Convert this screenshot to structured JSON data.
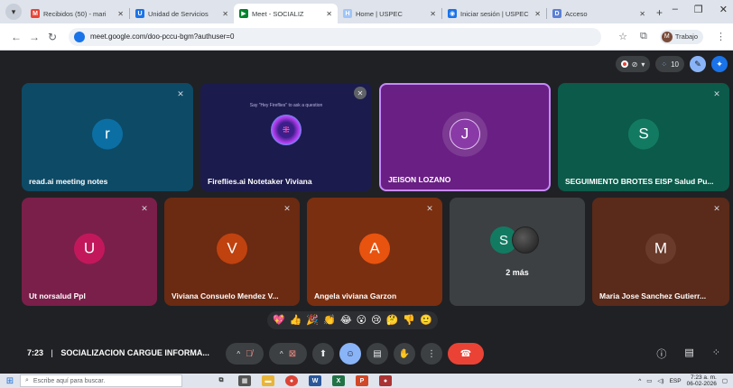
{
  "browser": {
    "tabs": [
      {
        "title": "Recibidos (50) - mari",
        "icon": "gmail-icon",
        "color": "#ea4335",
        "glyph": "M"
      },
      {
        "title": "Unidad de Servicios",
        "icon": "services-icon",
        "color": "#1a73e8",
        "glyph": "U"
      },
      {
        "title": "Meet - SOCIALIZ",
        "icon": "meet-icon",
        "color": "#00832d",
        "glyph": "▶",
        "active": true
      },
      {
        "title": "Home | USPEC",
        "icon": "uspec-icon",
        "color": "#9fc5f8",
        "glyph": "H"
      },
      {
        "title": "Iniciar sesión | USPEC",
        "icon": "login-icon",
        "color": "#1a73e8",
        "glyph": "◉"
      },
      {
        "title": "Acceso",
        "icon": "access-icon",
        "color": "#5b7fd6",
        "glyph": "D"
      }
    ],
    "url": "meet.google.com/doo-pccu-bgm?authuser=0",
    "profile_label": "Trabajo",
    "profile_initial": "M"
  },
  "meet_top": {
    "participant_count": "10"
  },
  "tiles": [
    {
      "name": "read.ai meeting notes",
      "initial": "r",
      "bg": "#0d4a66",
      "avatar": "#0b6fa4"
    },
    {
      "name": "Fireflies.ai Notetaker Viviana",
      "initial": "",
      "bg": "#1c1b4d",
      "avatar": "#4a2fa6",
      "fireflies_hint": "Say \"Hey Fireflies\" to ask a question"
    },
    {
      "name": "JEISON LOZANO",
      "initial": "J",
      "bg": "#6a1f84",
      "avatar": "#8a3aa6"
    },
    {
      "name": "SEGUIMIENTO BROTES EISP Salud Pu...",
      "initial": "S",
      "bg": "#0b5a4a",
      "avatar": "#137a62"
    },
    {
      "name": "Ut norsalud Ppl",
      "initial": "U",
      "bg": "#7a1f4a",
      "avatar": "#c2185b"
    },
    {
      "name": "Viviana Consuelo Mendez V...",
      "initial": "V",
      "bg": "#6b2a12",
      "avatar": "#c0420f"
    },
    {
      "name": "Angela viviana Garzon",
      "initial": "A",
      "bg": "#7a2f10",
      "avatar": "#e8530f"
    },
    {
      "name": "2 más",
      "initial": "S",
      "bg": "#3c4043",
      "avatar": "#137a62"
    },
    {
      "name": "Maria Jose Sanchez Gutierr...",
      "initial": "M",
      "bg": "#5a2a1a",
      "avatar": "#6a3a2a"
    }
  ],
  "reactions": [
    "💖",
    "👍",
    "🎉",
    "👏",
    "😂",
    "😮",
    "😢",
    "🤔",
    "👎",
    "🙂"
  ],
  "bottom": {
    "time": "7:23",
    "separator": "|",
    "meeting_title": "SOCIALIZACION CARGUE INFORMA..."
  },
  "taskbar": {
    "search_placeholder": "Escribe aquí para buscar.",
    "lang": "ESP",
    "time": "7:23 a. m.",
    "date": "06-02-2026"
  }
}
